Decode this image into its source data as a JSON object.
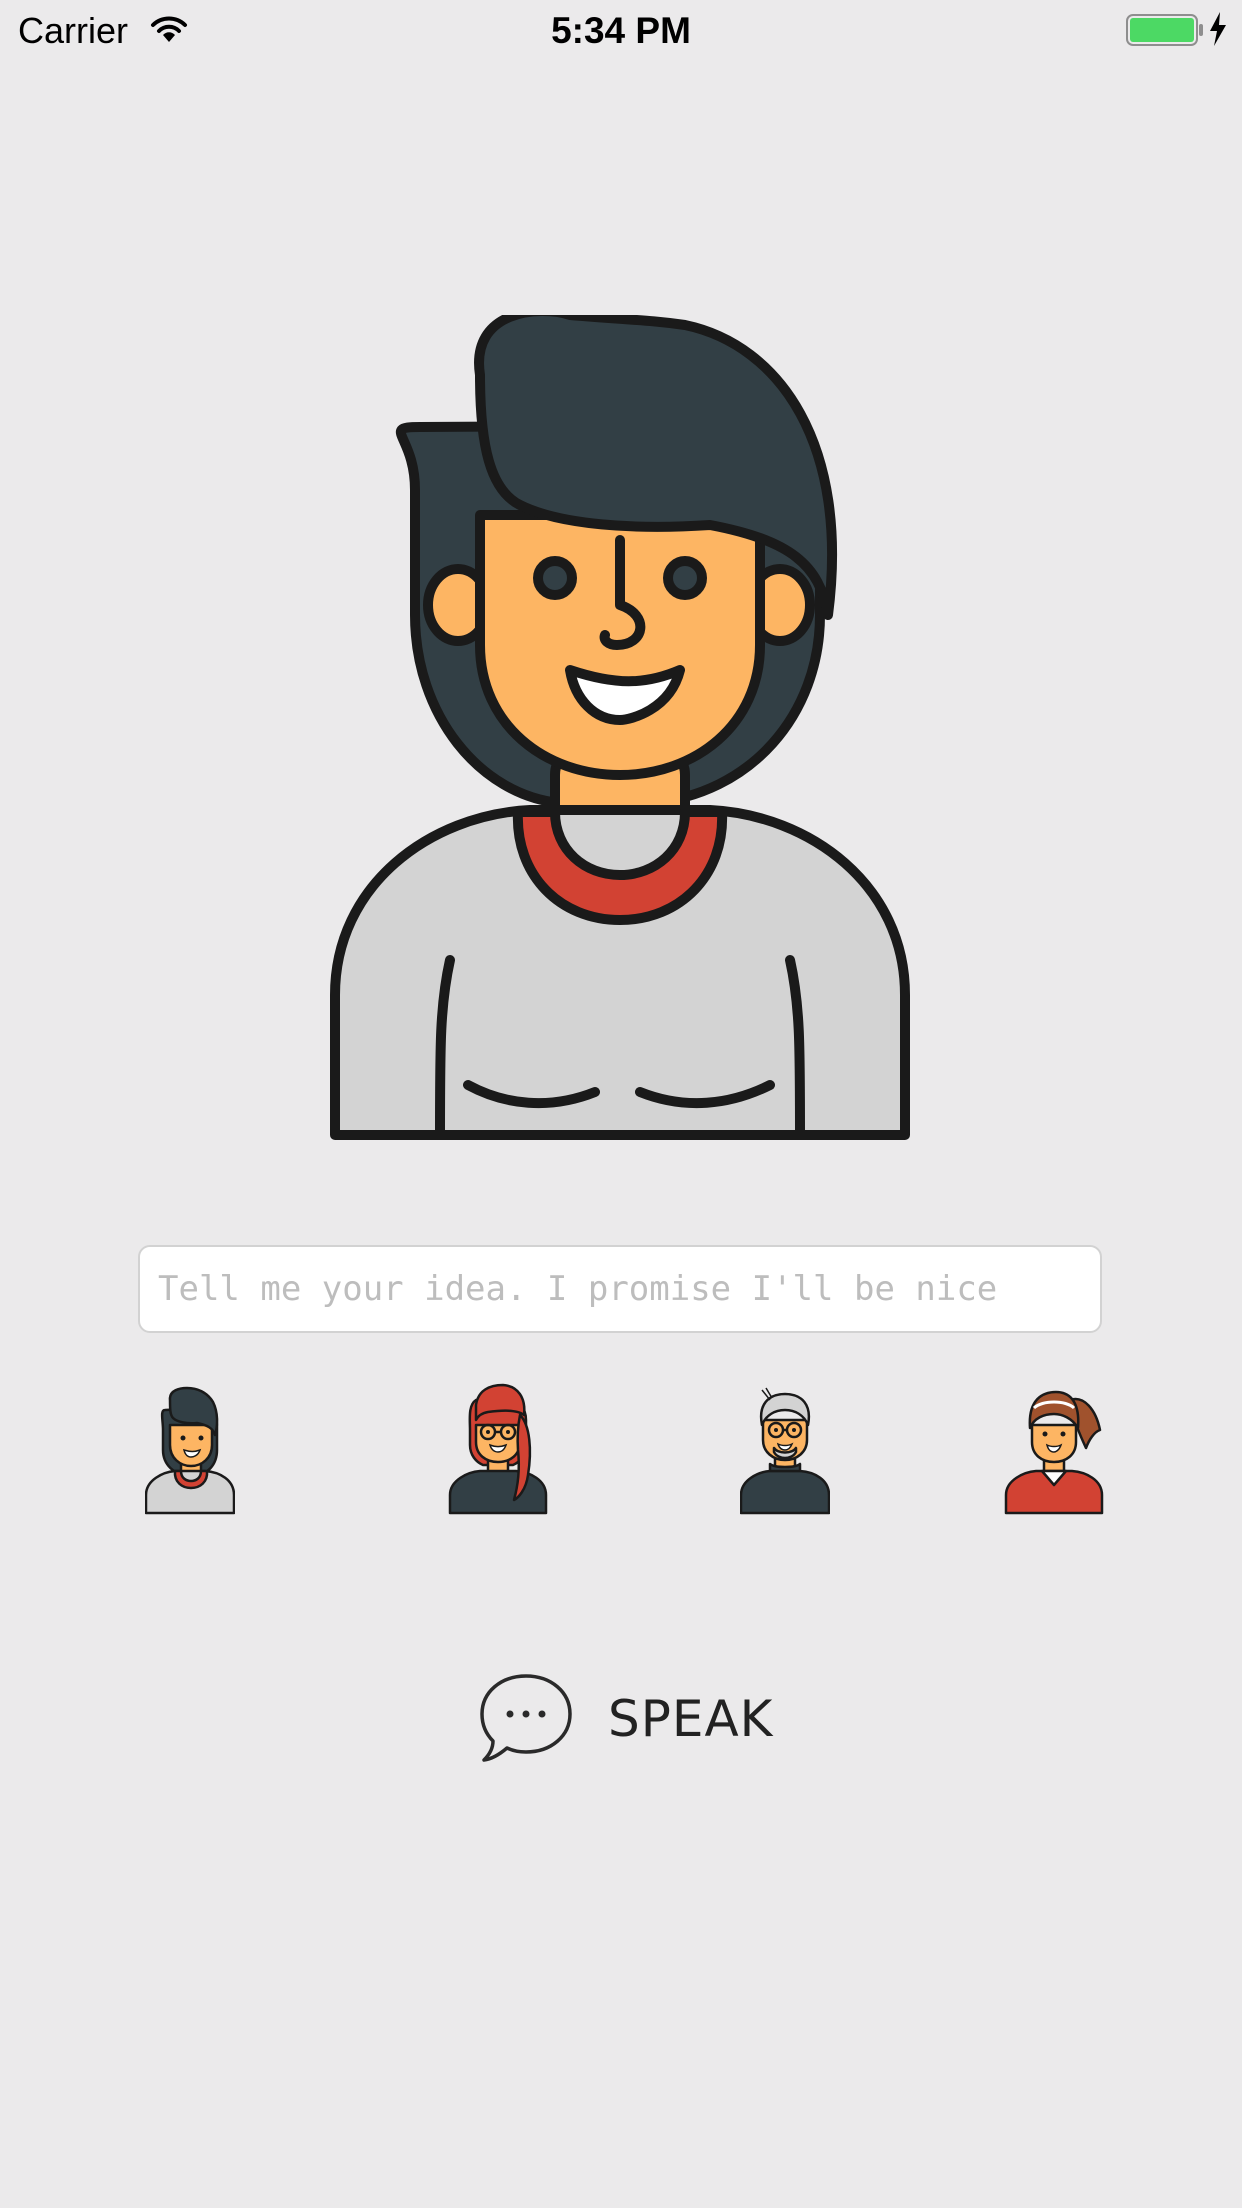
{
  "status_bar": {
    "carrier": "Carrier",
    "time": "5:34 PM",
    "battery_color": "#4cd964"
  },
  "main": {
    "selected_avatar": "woman-dark-short-hair",
    "idea_input": {
      "value": "",
      "placeholder": "Tell me your idea. I promise I'll be nice"
    },
    "avatar_options": [
      {
        "name": "woman-dark-short-hair"
      },
      {
        "name": "woman-red-hair-glasses"
      },
      {
        "name": "old-man-glasses"
      },
      {
        "name": "woman-brown-ponytail"
      }
    ],
    "speak_button": {
      "label": "SPEAK",
      "icon": "speech-bubble-icon"
    }
  },
  "colors": {
    "background": "#ebeaeb",
    "skin": "#fdb563",
    "hair_dark": "#323f45",
    "shirt": "#d3d3d3",
    "collar_red": "#d24233",
    "outline": "#1a1a1a"
  }
}
